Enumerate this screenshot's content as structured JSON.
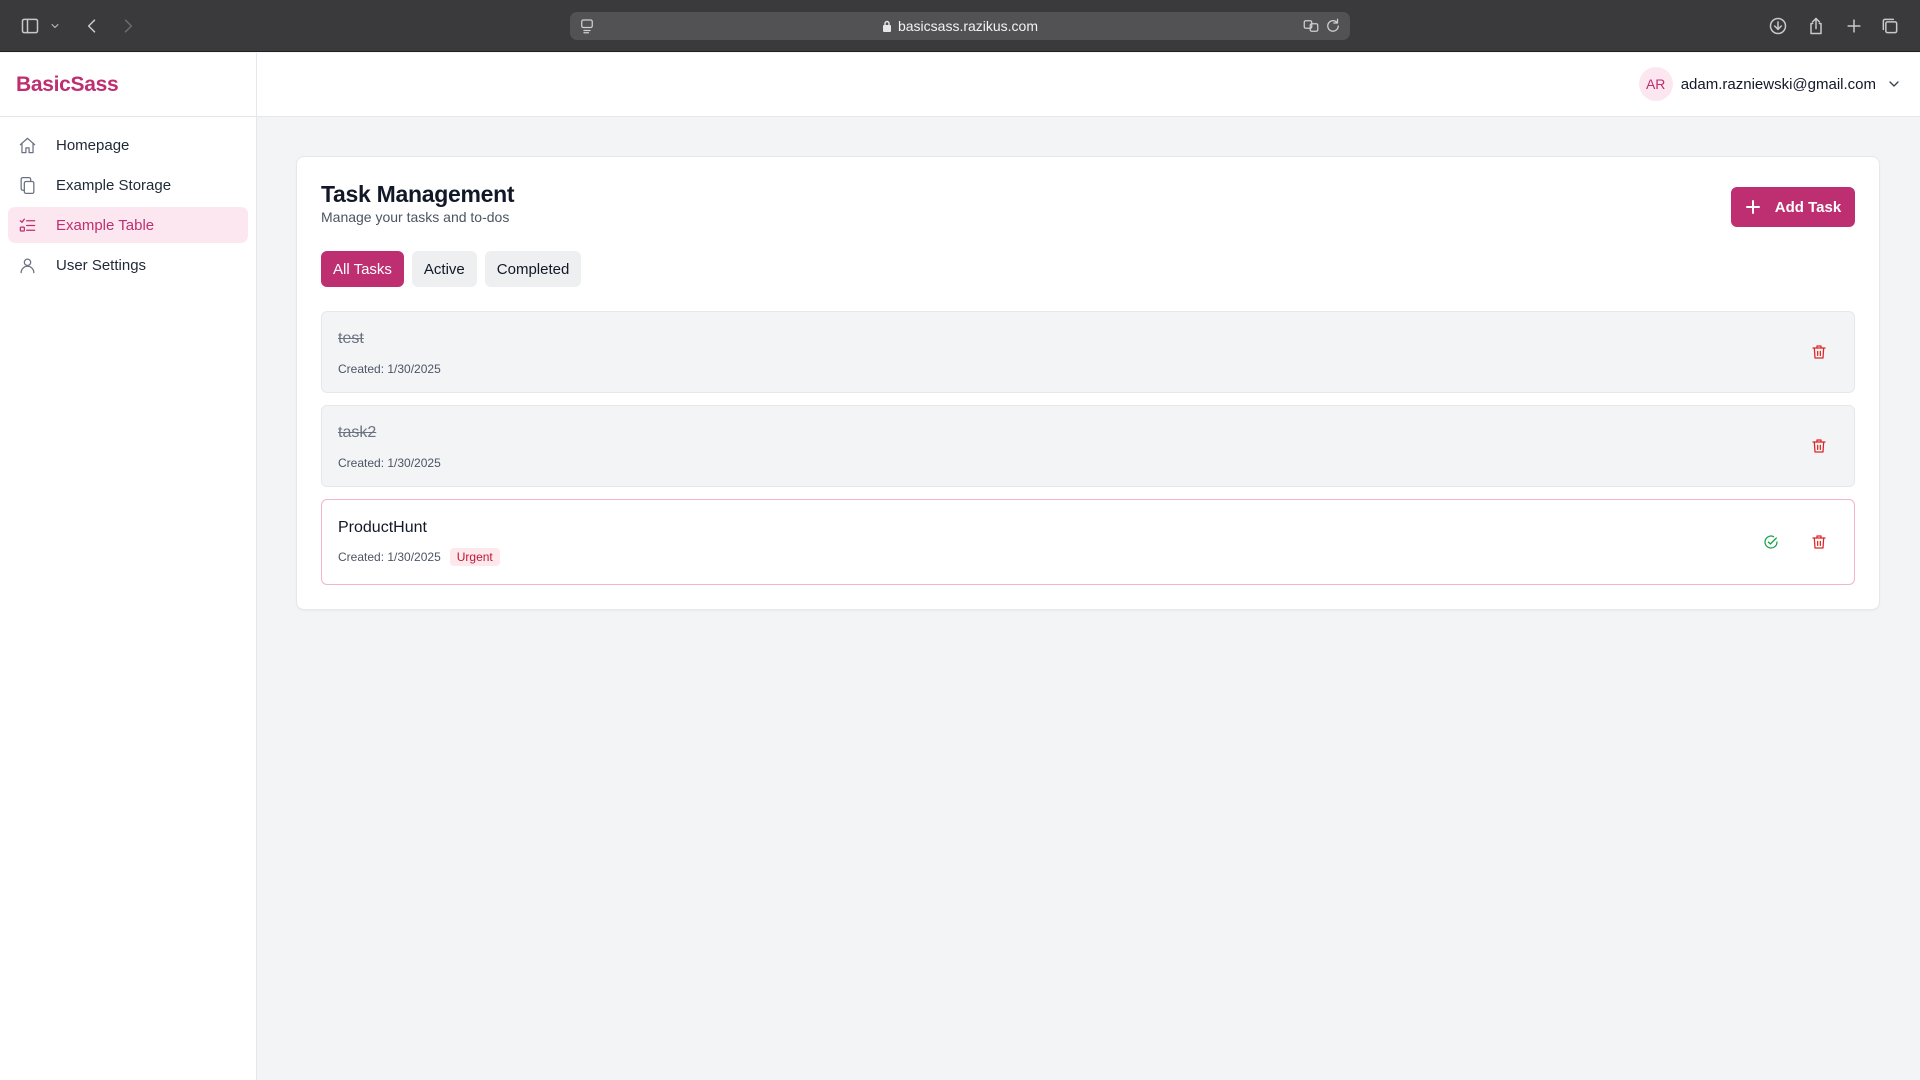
{
  "browser": {
    "url": "basicsass.razikus.com"
  },
  "sidebar": {
    "brand": "BasicSass",
    "items": [
      {
        "label": "Homepage",
        "icon": "home-icon"
      },
      {
        "label": "Example Storage",
        "icon": "documents-icon"
      },
      {
        "label": "Example Table",
        "icon": "list-checks-icon",
        "active": true
      },
      {
        "label": "User Settings",
        "icon": "user-icon"
      }
    ]
  },
  "header": {
    "avatar_initials": "AR",
    "email": "adam.razniewski@gmail.com"
  },
  "main": {
    "title": "Task Management",
    "subtitle": "Manage your tasks and to-dos",
    "add_button": "Add Task",
    "tabs": [
      {
        "label": "All Tasks",
        "active": true
      },
      {
        "label": "Active"
      },
      {
        "label": "Completed"
      }
    ],
    "tasks": [
      {
        "title": "test",
        "created": "Created: 1/30/2025",
        "completed": true
      },
      {
        "title": "task2",
        "created": "Created: 1/30/2025",
        "completed": true
      },
      {
        "title": "ProductHunt",
        "created": "Created: 1/30/2025",
        "completed": false,
        "badge": "Urgent"
      }
    ]
  },
  "colors": {
    "brand": "#be2f71",
    "brand_light": "#fce7f1",
    "danger": "#dc2626",
    "success": "#16a34a"
  }
}
